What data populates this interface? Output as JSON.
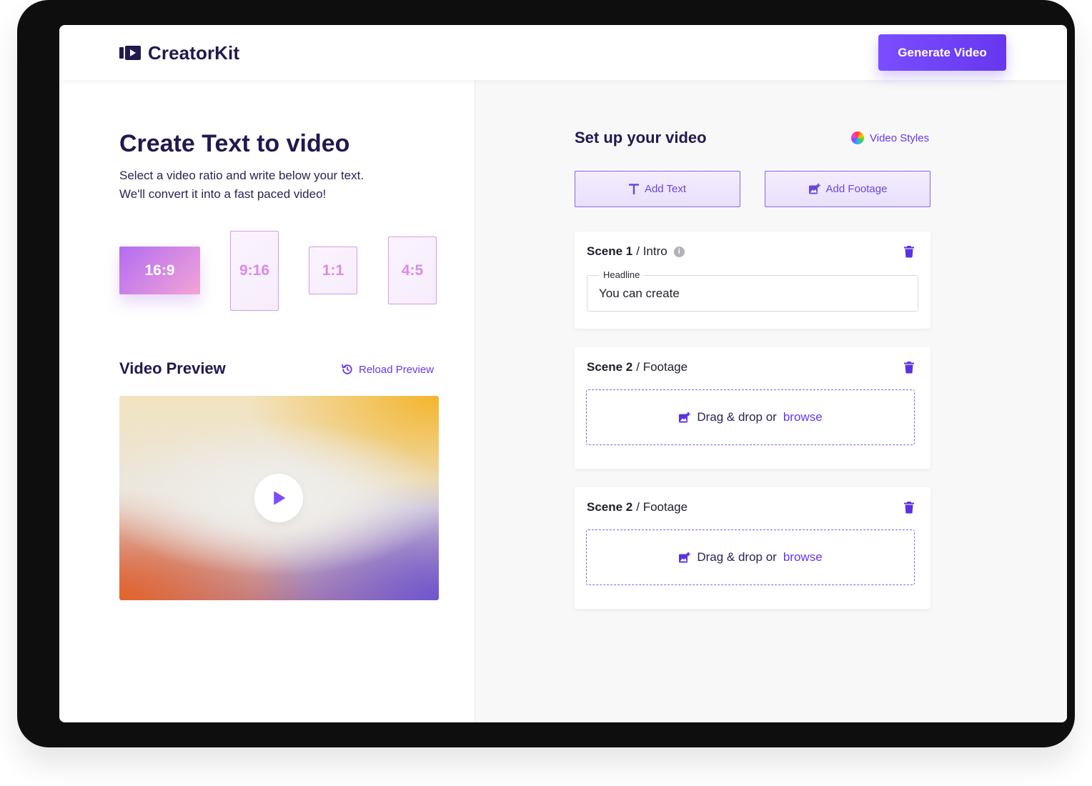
{
  "app": {
    "name": "CreatorKit",
    "generate_label": "Generate Video"
  },
  "left": {
    "title": "Create Text to video",
    "subtitle_line1": "Select a video ratio and write below your text.",
    "subtitle_line2": "We'll convert it into a fast paced video!",
    "ratios": [
      {
        "label": "16:9",
        "selected": true
      },
      {
        "label": "9:16",
        "selected": false
      },
      {
        "label": "1:1",
        "selected": false
      },
      {
        "label": "4:5",
        "selected": false
      }
    ],
    "preview_title": "Video Preview",
    "reload_label": "Reload Preview"
  },
  "right": {
    "title": "Set up your video",
    "styles_label": "Video Styles",
    "add_text_label": "Add Text",
    "add_footage_label": "Add Footage",
    "scenes": [
      {
        "num": "Scene 1",
        "type": "/ Intro",
        "field_label": "Headline",
        "field_value": "You can create"
      },
      {
        "num": "Scene 2",
        "type": "/ Footage",
        "drop_text": "Drag & drop or",
        "browse_text": "browse"
      },
      {
        "num": "Scene 2",
        "type": "/ Footage",
        "drop_text": "Drag & drop or",
        "browse_text": "browse"
      }
    ]
  },
  "icons": {
    "logo": "video-play-icon",
    "reload": "reload-icon",
    "styles": "color-wheel-icon",
    "add_text": "text-t-icon",
    "add_footage": "add-image-icon",
    "info": "info-icon",
    "delete": "trash-icon",
    "play": "play-icon"
  },
  "colors": {
    "accent": "#6637ee",
    "primary_text": "#23184f",
    "ratio_selected_start": "#b36cf2",
    "ratio_selected_end": "#f3a4d6"
  }
}
